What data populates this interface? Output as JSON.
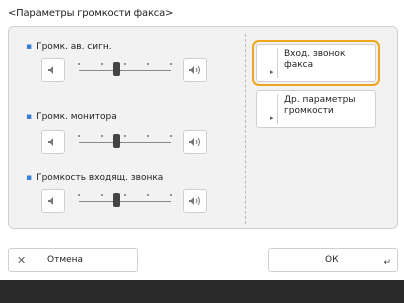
{
  "screen": {
    "title": "<Параметры громкости факса>"
  },
  "groups": [
    {
      "label": "Громк. ав. сигн.",
      "level": 0.4,
      "steps": 5
    },
    {
      "label": "Громк. монитора",
      "level": 0.4,
      "steps": 5
    },
    {
      "label": "Громкость входящ. звонка",
      "level": 0.4,
      "steps": 5
    }
  ],
  "right_buttons": [
    {
      "label_line1": "Вход. звонок",
      "label_line2": "факса",
      "selected": true
    },
    {
      "label_line1": "Др. параметры",
      "label_line2": "громкости",
      "selected": false
    }
  ],
  "footer": {
    "cancel_label": "Отмена",
    "ok_label": "ОК"
  },
  "colors": {
    "accent": "#f0a51e",
    "bullet": "#3a7fd5"
  }
}
